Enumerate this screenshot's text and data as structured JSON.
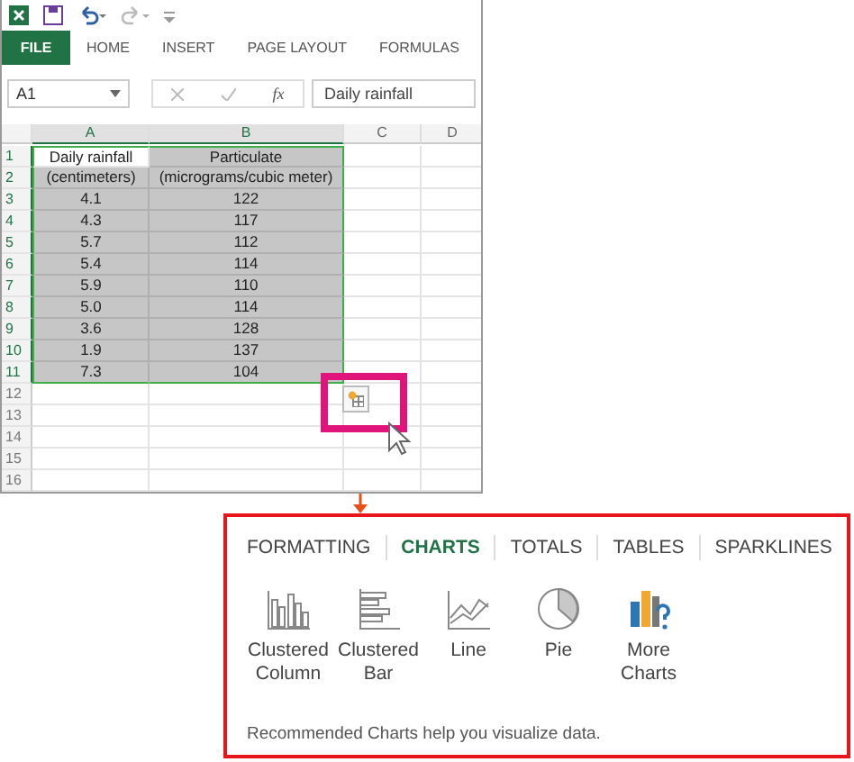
{
  "ribbon": {
    "tabs": [
      {
        "label": "FILE",
        "kind": "file"
      },
      {
        "label": "HOME",
        "kind": "tab"
      },
      {
        "label": "INSERT",
        "kind": "tab"
      },
      {
        "label": "PAGE LAYOUT",
        "kind": "tab"
      },
      {
        "label": "FORMULAS",
        "kind": "tab"
      }
    ]
  },
  "formula_bar": {
    "name_box": "A1",
    "function_label": "fx",
    "value": "Daily rainfall"
  },
  "columns": [
    "A",
    "B",
    "C",
    "D"
  ],
  "rows": [
    {
      "number": "1",
      "in_range": true,
      "cells": [
        {
          "text": "Daily rainfall",
          "selected": false
        },
        {
          "text": "Particulate",
          "selected": true
        }
      ]
    },
    {
      "number": "2",
      "in_range": true,
      "cells": [
        {
          "text": "(centimeters)",
          "selected": true
        },
        {
          "text": "(micrograms/cubic meter)",
          "selected": true
        }
      ]
    },
    {
      "number": "3",
      "in_range": true,
      "cells": [
        {
          "text": "4.1",
          "selected": true
        },
        {
          "text": "122",
          "selected": true
        }
      ]
    },
    {
      "number": "4",
      "in_range": true,
      "cells": [
        {
          "text": "4.3",
          "selected": true
        },
        {
          "text": "117",
          "selected": true
        }
      ]
    },
    {
      "number": "5",
      "in_range": true,
      "cells": [
        {
          "text": "5.7",
          "selected": true
        },
        {
          "text": "112",
          "selected": true
        }
      ]
    },
    {
      "number": "6",
      "in_range": true,
      "cells": [
        {
          "text": "5.4",
          "selected": true
        },
        {
          "text": "114",
          "selected": true
        }
      ]
    },
    {
      "number": "7",
      "in_range": true,
      "cells": [
        {
          "text": "5.9",
          "selected": true
        },
        {
          "text": "110",
          "selected": true
        }
      ]
    },
    {
      "number": "8",
      "in_range": true,
      "cells": [
        {
          "text": "5.0",
          "selected": true
        },
        {
          "text": "114",
          "selected": true
        }
      ]
    },
    {
      "number": "9",
      "in_range": true,
      "cells": [
        {
          "text": "3.6",
          "selected": true
        },
        {
          "text": "128",
          "selected": true
        }
      ]
    },
    {
      "number": "10",
      "in_range": true,
      "cells": [
        {
          "text": "1.9",
          "selected": true
        },
        {
          "text": "137",
          "selected": true
        }
      ]
    },
    {
      "number": "11",
      "in_range": true,
      "cells": [
        {
          "text": "7.3",
          "selected": true
        },
        {
          "text": "104",
          "selected": true
        }
      ]
    },
    {
      "number": "12",
      "in_range": false
    },
    {
      "number": "13",
      "in_range": false
    },
    {
      "number": "14",
      "in_range": false
    },
    {
      "number": "15",
      "in_range": false
    },
    {
      "number": "16",
      "in_range": false
    }
  ],
  "quick_analysis": {
    "tabs": [
      {
        "label": "FORMATTING",
        "selected": false
      },
      {
        "label": "CHARTS",
        "selected": true
      },
      {
        "label": "TOTALS",
        "selected": false
      },
      {
        "label": "TABLES",
        "selected": false
      },
      {
        "label": "SPARKLINES",
        "selected": false
      }
    ],
    "charts": [
      {
        "label": "Clustered Column",
        "kind": "column"
      },
      {
        "label": "Clustered Bar",
        "kind": "bar"
      },
      {
        "label": "Line",
        "kind": "line"
      },
      {
        "label": "Pie",
        "kind": "pie"
      },
      {
        "label": "More Charts",
        "kind": "more"
      }
    ],
    "footer": "Recommended Charts help you visualize data."
  }
}
